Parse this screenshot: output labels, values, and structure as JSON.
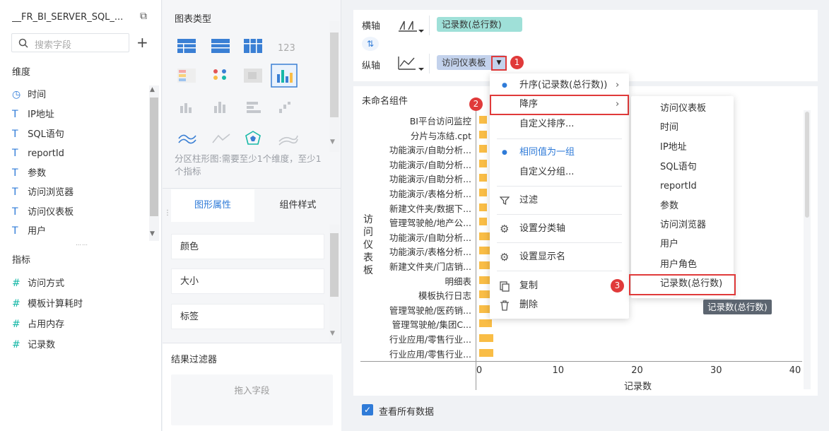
{
  "left": {
    "dataset_name": "__FR_BI_SERVER_SQL_...",
    "search_placeholder": "搜索字段",
    "dimension_header": "维度",
    "dimensions": [
      "时间",
      "IP地址",
      "SQL语句",
      "reportId",
      "参数",
      "访问浏览器",
      "访问仪表板",
      "用户"
    ],
    "measure_header": "指标",
    "measures": [
      "访问方式",
      "模板计算耗时",
      "占用内存",
      "记录数"
    ]
  },
  "mid": {
    "chart_type_title": "图表类型",
    "chart_hint": "分区柱形图:需要至少1个维度，至少1个指标",
    "tab_graph": "图形属性",
    "tab_style": "组件样式",
    "props": [
      "颜色",
      "大小",
      "标签"
    ],
    "filter_title": "结果过滤器",
    "filter_drop": "拖入字段"
  },
  "axis": {
    "x_label": "横轴",
    "x_field": "记录数(总行数)",
    "y_label": "纵轴",
    "y_field": "访问仪表板"
  },
  "chart": {
    "widget_name": "未命名组件",
    "show_all_label": "查看所有数据"
  },
  "chart_data": {
    "type": "bar",
    "orientation": "horizontal",
    "ylabel": "访问仪表板",
    "xlabel": "记录数",
    "xlim": [
      0,
      40
    ],
    "xticks": [
      0,
      10,
      20,
      30,
      40
    ],
    "categories": [
      "BI平台访问监控",
      "分片与冻结.cpt",
      "功能演示/自助分析...",
      "功能演示/自助分析...",
      "功能演示/自助分析...",
      "功能演示/表格分析...",
      "新建文件夹/数据下...",
      "管理驾驶舱/地产公...",
      "功能演示/自助分析...",
      "功能演示/表格分析...",
      "新建文件夹/门店销...",
      "明细表",
      "模板执行日志",
      "管理驾驶舱/医药销...",
      "管理驾驶舱/集团C...",
      "行业应用/零售行业...",
      "行业应用/零售行业..."
    ],
    "values": [
      1,
      1,
      1,
      1,
      1,
      1,
      1,
      1,
      1.6,
      1.6,
      1.6,
      1.6,
      1.6,
      1.6,
      1.6,
      1.8,
      1.8
    ]
  },
  "menu": {
    "items": [
      "升序(记录数(总行数))",
      "降序",
      "自定义排序...",
      "相同值为一组",
      "自定义分组...",
      "过滤",
      "设置分类轴",
      "设置显示名",
      "复制",
      "删除"
    ]
  },
  "submenu": {
    "items": [
      "访问仪表板",
      "时间",
      "IP地址",
      "SQL语句",
      "reportId",
      "参数",
      "访问浏览器",
      "用户",
      "用户角色",
      "记录数(总行数)"
    ]
  },
  "tooltip": "记录数(总行数)",
  "badges": [
    "1",
    "2",
    "3"
  ],
  "colors": {
    "accent": "#2f7bd8",
    "bar": "#f9bd46",
    "highlight": "#e03a3a",
    "x_pill": "#9fe0d8",
    "y_pill": "#c3d2ec"
  }
}
